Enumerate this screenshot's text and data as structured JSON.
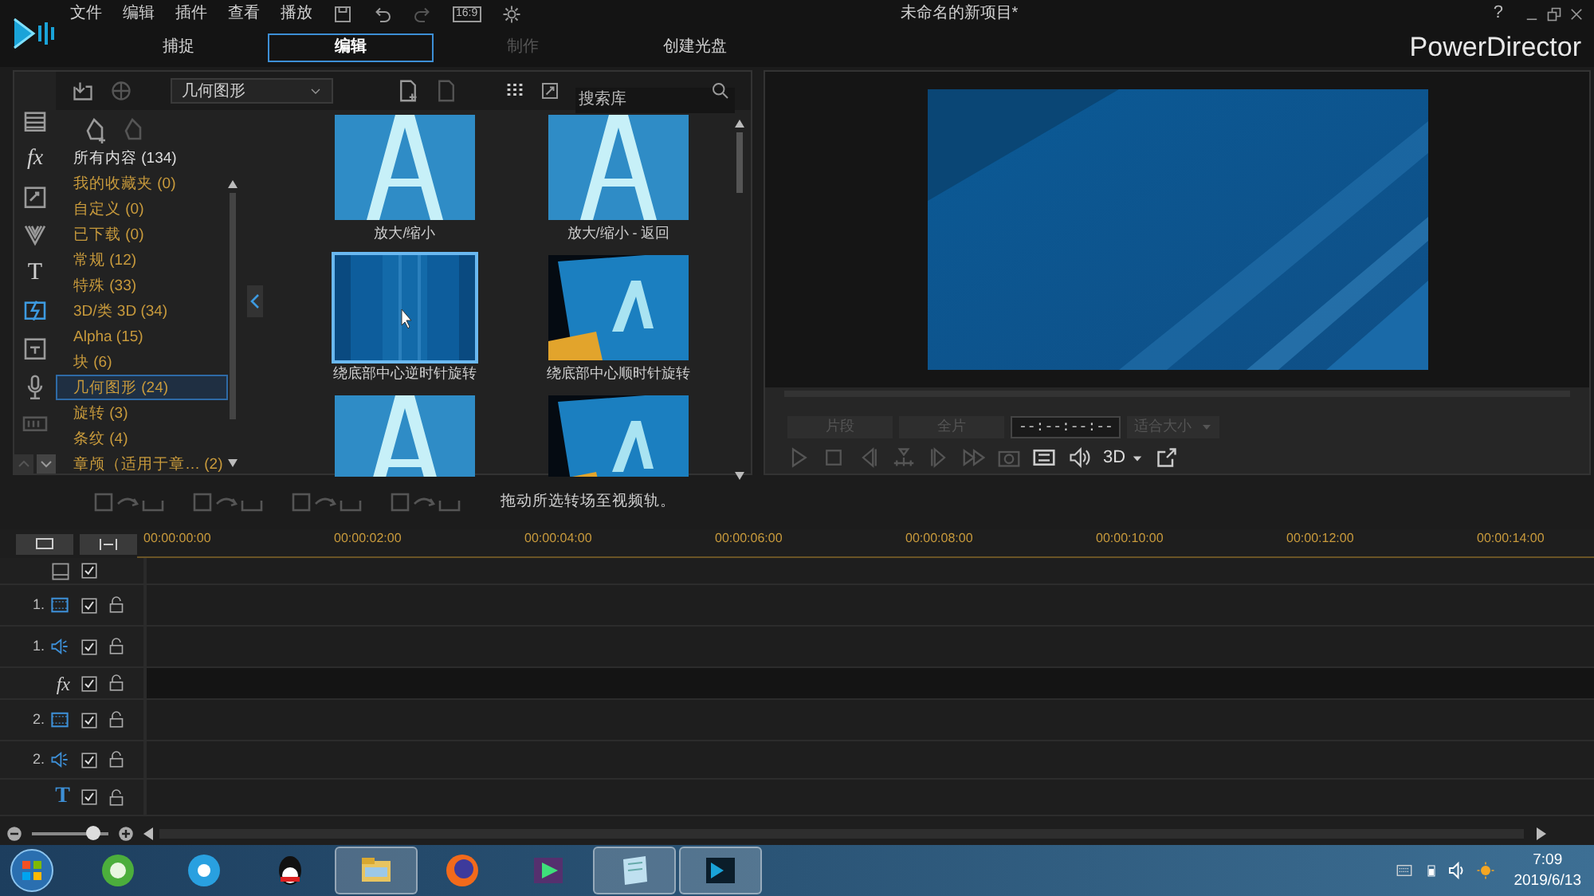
{
  "window": {
    "title": "未命名的新项目*",
    "brand": "PowerDirector",
    "help": "?"
  },
  "menu": [
    "文件",
    "编辑",
    "插件",
    "查看",
    "播放"
  ],
  "quick_tools": {
    "aspect": "16:9"
  },
  "tabs": [
    {
      "label": "捕捉",
      "selected": false,
      "disabled": false
    },
    {
      "label": "编辑",
      "selected": true,
      "disabled": false
    },
    {
      "label": "制作",
      "selected": false,
      "disabled": true
    },
    {
      "label": "创建光盘",
      "selected": false,
      "disabled": false
    }
  ],
  "library": {
    "side_tools": [
      {
        "kind": "media",
        "selected": false
      },
      {
        "kind": "effects",
        "label": "fx",
        "selected": false
      },
      {
        "kind": "pip",
        "selected": false
      },
      {
        "kind": "particle",
        "selected": false
      },
      {
        "kind": "title",
        "label": "T",
        "selected": false
      },
      {
        "kind": "transition",
        "selected": true
      },
      {
        "kind": "subtitle",
        "selected": false
      },
      {
        "kind": "voice",
        "selected": false
      },
      {
        "kind": "chapter",
        "selected": false
      }
    ],
    "dropdown": "几何图形",
    "search_placeholder": "搜索库",
    "categories": [
      {
        "label": "所有内容 (134)",
        "kind": "all",
        "selected": false
      },
      {
        "label": "我的收藏夹 (0)",
        "kind": "group",
        "selected": false
      },
      {
        "label": "自定义 (0)",
        "kind": "group",
        "selected": false
      },
      {
        "label": "已下载 (0)",
        "kind": "group",
        "selected": false
      },
      {
        "label": "常规 (12)",
        "kind": "group",
        "selected": false
      },
      {
        "label": "特殊 (33)",
        "kind": "group",
        "selected": false
      },
      {
        "label": "3D/类 3D (34)",
        "kind": "group",
        "selected": false
      },
      {
        "label": "Alpha (15)",
        "kind": "group",
        "selected": false
      },
      {
        "label": "块 (6)",
        "kind": "group",
        "selected": false
      },
      {
        "label": "几何图形 (24)",
        "kind": "group",
        "selected": true
      },
      {
        "label": "旋转 (3)",
        "kind": "group",
        "selected": false
      },
      {
        "label": "条纹 (4)",
        "kind": "group",
        "selected": false
      },
      {
        "label": "章颅（适用于章…  (2)",
        "kind": "group",
        "selected": false
      }
    ],
    "thumbnails": [
      {
        "caption": "放大/缩小",
        "kind": "letter",
        "selected": false
      },
      {
        "caption": "放大/缩小 - 返回",
        "kind": "letter",
        "selected": false
      },
      {
        "caption": "绕底部中心逆时针旋转",
        "kind": "plain",
        "selected": true
      },
      {
        "caption": "绕底部中心顺时针旋转",
        "kind": "tilted",
        "selected": false
      },
      {
        "kind": "letter",
        "selected": false
      },
      {
        "kind": "tilted",
        "selected": false
      }
    ]
  },
  "preview": {
    "clip_button": "片段",
    "movie_button": "全片",
    "timecode": "--:--:--:--",
    "fit": "适合大小",
    "mode_3d": "3D"
  },
  "transition_hint": "拖动所选转场至视频轨。",
  "timeline": {
    "ruler": [
      "00:00:00:00",
      "00:00:02:00",
      "00:00:04:00",
      "00:00:06:00",
      "00:00:08:00",
      "00:00:10:00",
      "00:00:12:00",
      "00:00:14:00"
    ],
    "tracks": [
      {
        "kind": "chapter",
        "checked": true
      },
      {
        "kind": "video",
        "number": "1.",
        "checked": true,
        "locked": false
      },
      {
        "kind": "audio",
        "number": "1.",
        "checked": true,
        "locked": false
      },
      {
        "kind": "effect",
        "label": "fx",
        "checked": true,
        "locked": false
      },
      {
        "kind": "video",
        "number": "2.",
        "checked": true,
        "locked": false
      },
      {
        "kind": "audio",
        "number": "2.",
        "checked": true,
        "locked": false
      },
      {
        "kind": "title",
        "label": "T",
        "checked": true,
        "locked": false
      }
    ],
    "zoom": {
      "level": 0.8
    }
  },
  "taskbar": {
    "apps": [
      {
        "kind": "ie",
        "active": false
      },
      {
        "kind": "media",
        "active": false
      },
      {
        "kind": "qq",
        "active": false
      },
      {
        "kind": "explorer",
        "active": true
      },
      {
        "kind": "firefox",
        "active": false
      },
      {
        "kind": "player",
        "active": false
      },
      {
        "kind": "notepad",
        "active": true
      },
      {
        "kind": "powerdirector",
        "active": true
      }
    ],
    "time": "7:09",
    "date": "2019/6/13"
  }
}
